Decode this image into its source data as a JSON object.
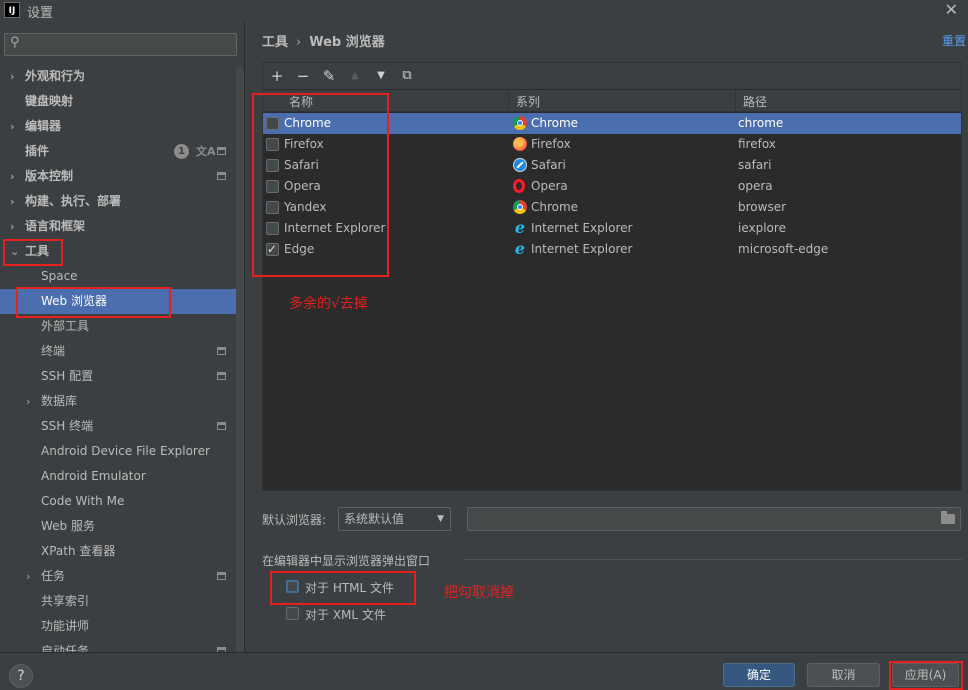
{
  "window": {
    "title": "设置",
    "logo": "IJ"
  },
  "search": {
    "placeholder": "",
    "icon": "search-icon"
  },
  "sidebar": {
    "items": [
      {
        "label": "外观和行为",
        "level": 0,
        "arrow": "›",
        "bold": true
      },
      {
        "label": "键盘映射",
        "level": 0,
        "arrow": "",
        "bold": true
      },
      {
        "label": "编辑器",
        "level": 0,
        "arrow": "›",
        "bold": true
      },
      {
        "label": "插件",
        "level": 0,
        "arrow": "",
        "bold": true,
        "badge": "1",
        "proj": true
      },
      {
        "label": "版本控制",
        "level": 0,
        "arrow": "›",
        "bold": true,
        "proj": true
      },
      {
        "label": "构建、执行、部署",
        "level": 0,
        "arrow": "›",
        "bold": true
      },
      {
        "label": "语言和框架",
        "level": 0,
        "arrow": "›",
        "bold": true
      },
      {
        "label": "工具",
        "level": 0,
        "arrow": "⌄",
        "bold": true
      },
      {
        "label": "Space",
        "level": 1,
        "arrow": ""
      },
      {
        "label": "Web 浏览器",
        "level": 1,
        "arrow": "",
        "selected": true
      },
      {
        "label": "外部工具",
        "level": 1,
        "arrow": ""
      },
      {
        "label": "终端",
        "level": 1,
        "arrow": "",
        "proj": true
      },
      {
        "label": "SSH 配置",
        "level": 1,
        "arrow": "",
        "proj": true
      },
      {
        "label": "数据库",
        "level": 1,
        "arrow": "›"
      },
      {
        "label": "SSH 终端",
        "level": 1,
        "arrow": "",
        "proj": true
      },
      {
        "label": "Android Device File Explorer",
        "level": 1,
        "arrow": ""
      },
      {
        "label": "Android Emulator",
        "level": 1,
        "arrow": ""
      },
      {
        "label": "Code With Me",
        "level": 1,
        "arrow": ""
      },
      {
        "label": "Web 服务",
        "level": 1,
        "arrow": ""
      },
      {
        "label": "XPath 查看器",
        "level": 1,
        "arrow": ""
      },
      {
        "label": "任务",
        "level": 1,
        "arrow": "›",
        "proj": true
      },
      {
        "label": "共享索引",
        "level": 1,
        "arrow": ""
      },
      {
        "label": "功能讲师",
        "level": 1,
        "arrow": ""
      },
      {
        "label": "启动任务",
        "level": 1,
        "arrow": "",
        "proj": true
      }
    ]
  },
  "breadcrumb": {
    "parent": "工具",
    "separator": "›",
    "current": "Web 浏览器"
  },
  "reset": "重置",
  "toolbar": {
    "add": "+",
    "remove": "−",
    "edit": "✎",
    "up": "▲",
    "down": "▼",
    "copy": "⧉"
  },
  "table": {
    "headers": {
      "name": "名称",
      "family": "系列",
      "path": "路径"
    },
    "rows": [
      {
        "name": "Chrome",
        "family": "Chrome",
        "family_icon": "chrome",
        "path": "chrome",
        "checked": false,
        "selected": true
      },
      {
        "name": "Firefox",
        "family": "Firefox",
        "family_icon": "firefox",
        "path": "firefox",
        "checked": false
      },
      {
        "name": "Safari",
        "family": "Safari",
        "family_icon": "safari",
        "path": "safari",
        "checked": false
      },
      {
        "name": "Opera",
        "family": "Opera",
        "family_icon": "opera",
        "path": "opera",
        "checked": false
      },
      {
        "name": "Yandex",
        "family": "Chrome",
        "family_icon": "chrome",
        "path": "browser",
        "checked": false
      },
      {
        "name": "Internet Explorer",
        "family": "Internet Explorer",
        "family_icon": "ie",
        "path": "iexplore",
        "checked": false
      },
      {
        "name": "Edge",
        "family": "Internet Explorer",
        "family_icon": "ie",
        "path": "microsoft-edge",
        "checked": true
      }
    ]
  },
  "annotations": {
    "remove_checks": "多余的√去掉",
    "uncheck": "把勾取消掉"
  },
  "default_browser": {
    "label": "默认浏览器:",
    "value": "系统默认值",
    "path_value": ""
  },
  "popup_section": {
    "title": "在编辑器中显示浏览器弹出窗口",
    "html_label": "对于 HTML 文件",
    "html_checked": false,
    "xml_label": "对于 XML 文件",
    "xml_checked": false
  },
  "footer": {
    "help": "?",
    "ok": "确定",
    "cancel": "取消",
    "apply": "应用(A)"
  },
  "colors": {
    "accent": "#4b6eaf",
    "annotation": "#e5201e",
    "link": "#589df6"
  }
}
